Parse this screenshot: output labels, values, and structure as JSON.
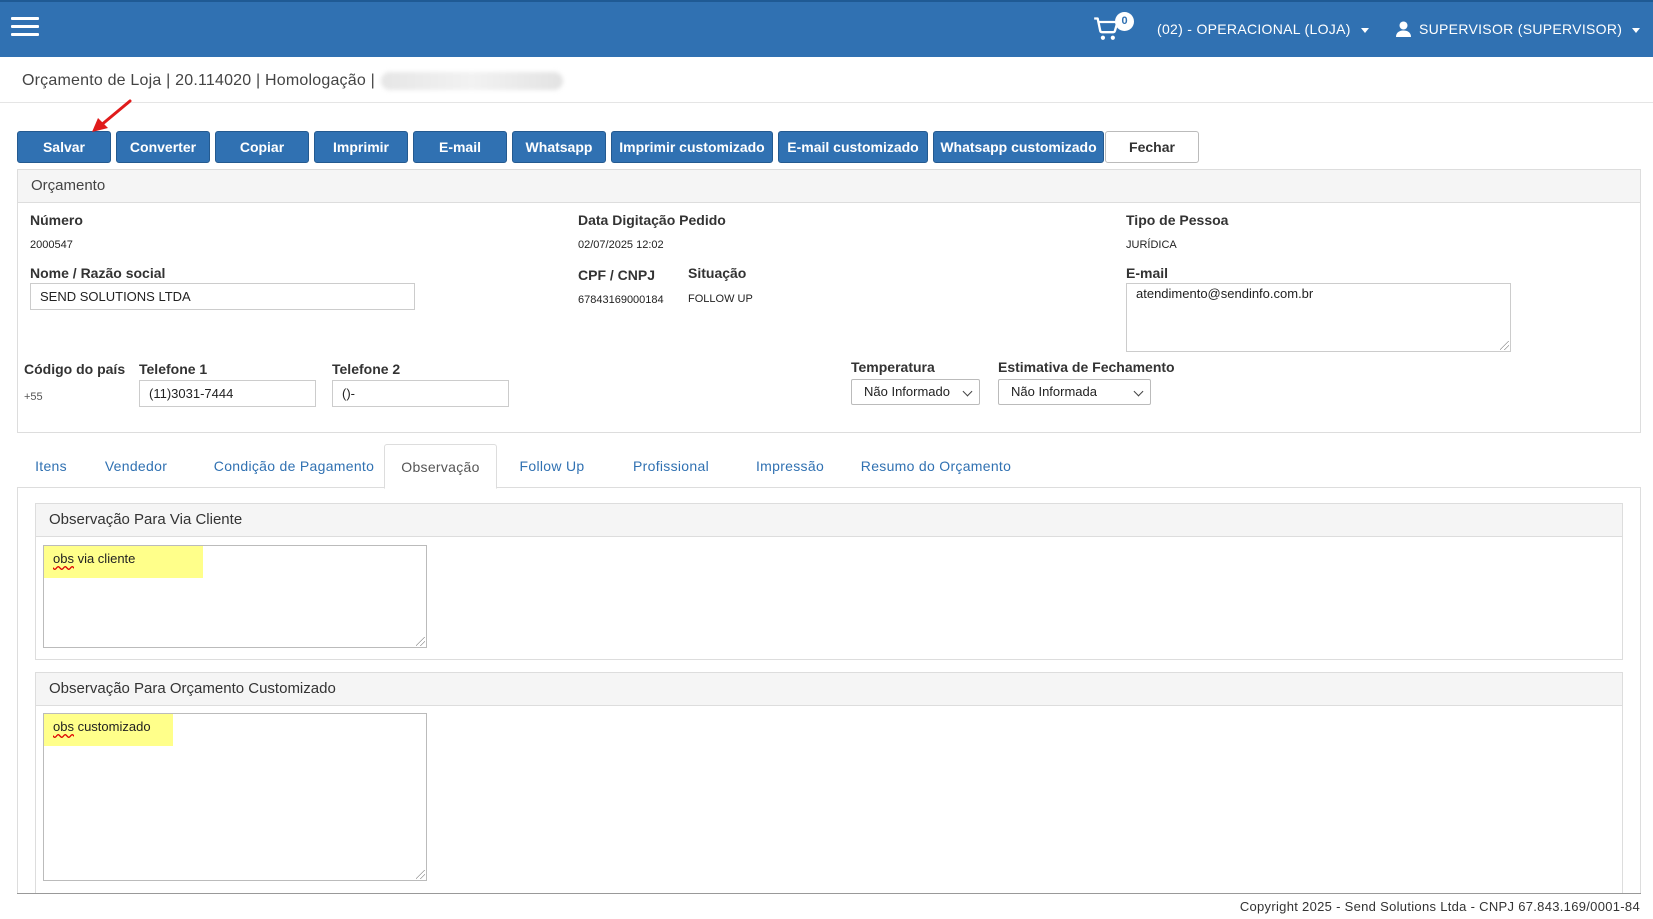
{
  "navbar": {
    "cart_count": "0",
    "store_label": "(02) - OPERACIONAL (LOJA)",
    "user_label": "SUPERVISOR (SUPERVISOR)"
  },
  "breadcrumb": {
    "text": "Orçamento de Loja | 20.114020 | Homologação |"
  },
  "toolbar": {
    "salvar": "Salvar",
    "converter": "Converter",
    "copiar": "Copiar",
    "imprimir": "Imprimir",
    "email": "E-mail",
    "whatsapp": "Whatsapp",
    "imprimir_custom": "Imprimir customizado",
    "email_custom": "E-mail customizado",
    "whatsapp_custom": "Whatsapp customizado",
    "fechar": "Fechar"
  },
  "orcamento": {
    "title": "Orçamento",
    "numero_label": "Número",
    "numero": "2000547",
    "data_label": "Data Digitação Pedido",
    "data": "02/07/2025 12:02",
    "tipo_label": "Tipo de Pessoa",
    "tipo": "JURÍDICA",
    "nome_label": "Nome / Razão social",
    "nome": "SEND SOLUTIONS LTDA",
    "cpf_label": "CPF / CNPJ",
    "cpf": "67843169000184",
    "situacao_label": "Situação",
    "situacao": "FOLLOW UP",
    "email_label": "E-mail",
    "email": "atendimento@sendinfo.com.br",
    "codigo_label": "Código do país",
    "codigo": "+55",
    "tel1_label": "Telefone 1",
    "tel1": "(11)3031-7444",
    "tel2_label": "Telefone 2",
    "tel2": "()-",
    "temperatura_label": "Temperatura",
    "temperatura": "Não Informado",
    "estimativa_label": "Estimativa de Fechamento",
    "estimativa": "Não Informada"
  },
  "tabs": {
    "itens": "Itens",
    "vendedor": "Vendedor",
    "condicao": "Condição de Pagamento",
    "observacao": "Observação",
    "followup": "Follow Up",
    "profissional": "Profissional",
    "impressao": "Impressão",
    "resumo": "Resumo do Orçamento"
  },
  "observacao": {
    "cliente_title": "Observação Para Via Cliente",
    "cliente_word1": "obs",
    "cliente_rest": " via cliente",
    "custom_title": "Observação Para Orçamento Customizado",
    "custom_word1": "obs",
    "custom_rest": " customizado"
  },
  "footer": {
    "copyright": "Copyright 2025 - Send Solutions Ltda - CNPJ 67.843.169/0001-84"
  },
  "colors": {
    "primary": "#3071b2",
    "highlight": "#ffff8a",
    "arrow": "#e01b1b"
  }
}
